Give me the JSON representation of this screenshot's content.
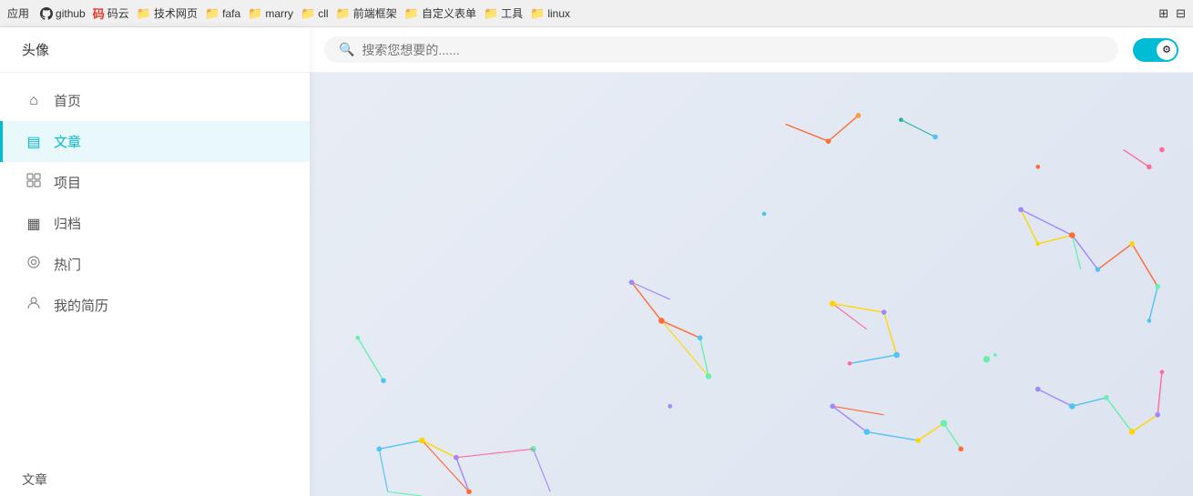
{
  "browser": {
    "apps_label": "应用",
    "bookmarks": [
      {
        "icon": "github",
        "label": "github"
      },
      {
        "icon": "码云",
        "label": "码云"
      },
      {
        "icon": "folder",
        "label": "技术网页"
      },
      {
        "icon": "folder",
        "label": "fafa"
      },
      {
        "icon": "folder",
        "label": "marry"
      },
      {
        "icon": "folder",
        "label": "cll"
      },
      {
        "icon": "folder",
        "label": "前端框架"
      },
      {
        "icon": "folder",
        "label": "自定义表单"
      },
      {
        "icon": "folder",
        "label": "工具"
      },
      {
        "icon": "folder",
        "label": "linux"
      }
    ]
  },
  "sidebar": {
    "header_label": "头像",
    "nav_items": [
      {
        "id": "home",
        "icon": "⌂",
        "label": "首页",
        "active": false
      },
      {
        "id": "article",
        "icon": "▤",
        "label": "文章",
        "active": true
      },
      {
        "id": "project",
        "icon": "⊞",
        "label": "项目",
        "active": false
      },
      {
        "id": "archive",
        "icon": "▦",
        "label": "归档",
        "active": false
      },
      {
        "id": "hot",
        "icon": "◎",
        "label": "热门",
        "active": false
      },
      {
        "id": "resume",
        "icon": "☺",
        "label": "我的简历",
        "active": false
      }
    ],
    "section_label": "文章"
  },
  "search": {
    "placeholder": "搜索您想要的......"
  },
  "toggle": {
    "icon": "⚙",
    "active": true
  }
}
